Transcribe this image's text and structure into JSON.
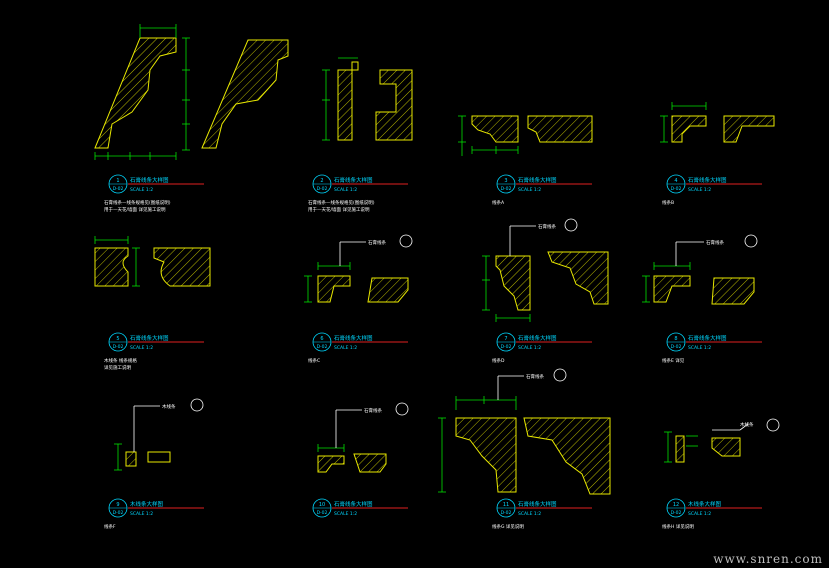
{
  "sheet": {
    "background": "#000000",
    "colors": {
      "profile": "#e8e800",
      "dimension": "#00e000",
      "leader": "#ffffff",
      "title_line": "#e02020",
      "title_text": "#00d8ff"
    }
  },
  "details": [
    {
      "num": "1",
      "sheet": "D-02",
      "title": "石膏线条大样图",
      "scale": "SCALE 1:2",
      "notes": [
        "石膏线条—线条规格见(图纸说明)",
        "用于—天花/墙面 详见施工说明"
      ],
      "callout": ""
    },
    {
      "num": "2",
      "sheet": "D-02",
      "title": "石膏线条大样图",
      "scale": "SCALE 1:2",
      "notes": [
        "石膏线条—线条规格见(图纸说明)",
        "用于—天花/墙面 详见施工说明"
      ],
      "callout": ""
    },
    {
      "num": "3",
      "sheet": "D-02",
      "title": "石膏线条大样图",
      "scale": "SCALE 1:2",
      "notes": [
        "线条A"
      ],
      "callout": ""
    },
    {
      "num": "4",
      "sheet": "D-02",
      "title": "石膏线条大样图",
      "scale": "SCALE 1:2",
      "notes": [
        "线条B"
      ],
      "callout": ""
    },
    {
      "num": "5",
      "sheet": "D-02",
      "title": "石膏线条大样图",
      "scale": "SCALE 1:2",
      "notes": [
        "木线条 线条规格",
        "详见施工说明"
      ],
      "callout": ""
    },
    {
      "num": "6",
      "sheet": "D-02",
      "title": "石膏线条大样图",
      "scale": "SCALE 1:2",
      "notes": [
        "线条C"
      ],
      "callout": "石膏线条"
    },
    {
      "num": "7",
      "sheet": "D-02",
      "title": "石膏线条大样图",
      "scale": "SCALE 1:2",
      "notes": [
        "线条D"
      ],
      "callout": "石膏线条"
    },
    {
      "num": "8",
      "sheet": "D-02",
      "title": "石膏线条大样图",
      "scale": "SCALE 1:2",
      "notes": [
        "线条E 详见"
      ],
      "callout": "石膏线条"
    },
    {
      "num": "9",
      "sheet": "D-02",
      "title": "木线条大样图",
      "scale": "SCALE 1:2",
      "notes": [
        "线条F"
      ],
      "callout": "木线条"
    },
    {
      "num": "10",
      "sheet": "D-02",
      "title": "石膏线条大样图",
      "scale": "SCALE 1:2",
      "notes": [],
      "callout": "石膏线条"
    },
    {
      "num": "11",
      "sheet": "D-02",
      "title": "石膏线条大样图",
      "scale": "SCALE 1:2",
      "notes": [
        "线条G 详见说明"
      ],
      "callout": "石膏线条"
    },
    {
      "num": "12",
      "sheet": "D-02",
      "title": "木线条大样图",
      "scale": "SCALE 1:2",
      "notes": [
        "线条H 详见说明"
      ],
      "callout": "木线条"
    }
  ],
  "watermark": "www.snren.com"
}
